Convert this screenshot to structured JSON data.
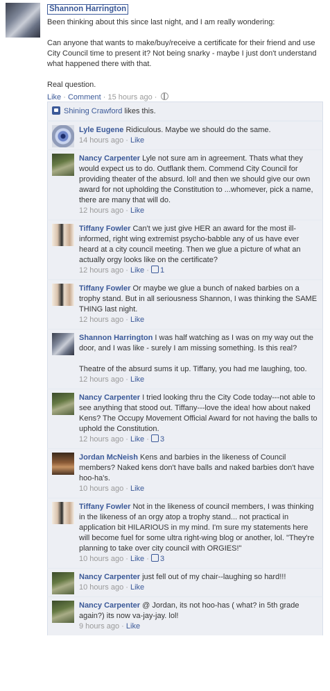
{
  "post": {
    "author": "Shannon Harrington",
    "text": "Been thinking about this since last night, and I am really wondering:\n\nCan anyone that wants to make/buy/receive a certificate for their friend and use City Council time to present it? Not being snarky - maybe I just don't understand what happened there with that.\n\nReal question.",
    "like_label": "Like",
    "comment_label": "Comment",
    "time": "15 hours ago",
    "privacy_icon": "globe-icon"
  },
  "likes": {
    "name": "Shining Crawford",
    "suffix": "likes this."
  },
  "comments": [
    {
      "author": "Lyle Eugene",
      "text": "Ridiculous. Maybe we should do the same.",
      "time": "14 hours ago",
      "like": "Like",
      "likes": ""
    },
    {
      "author": "Nancy Carpenter",
      "text": "Lyle not sure am in agreement. Thats what they would expect us to do. Outflank them. Commend City Council for providing theater of the absurd. lol! and then we should give our own award for not upholding the Constitution to ...whomever, pick a name, there are many that will do.",
      "time": "12 hours ago",
      "like": "Like",
      "likes": ""
    },
    {
      "author": "Tiffany Fowler",
      "text": "Can't we just give HER an award for the most ill-informed, right wing extremist psycho-babble any of us have ever heard at a city council meeting. Then we glue a picture of what an actually orgy looks like on the certificate?",
      "time": "12 hours ago",
      "like": "Like",
      "likes": "1"
    },
    {
      "author": "Tiffany Fowler",
      "text": "Or maybe we glue a bunch of naked barbies on a trophy stand. But in all seriousness Shannon, I was thinking the SAME THING last night.",
      "time": "12 hours ago",
      "like": "Like",
      "likes": ""
    },
    {
      "author": "Shannon Harrington",
      "text": "I was half watching as I was on my way out the door, and I was like - surely I am missing something. Is this real?\n\nTheatre of the absurd sums it up. Tiffany, you had me laughing, too.",
      "time": "12 hours ago",
      "like": "Like",
      "likes": ""
    },
    {
      "author": "Nancy Carpenter",
      "text": "I tried looking thru the City Code today---not able to see anything that stood out. Tiffany---love the idea! how about naked Kens? The Occupy Movement Official Award for not having the balls to uphold the Constitution.",
      "time": "12 hours ago",
      "like": "Like",
      "likes": "3"
    },
    {
      "author": "Jordan McNeish",
      "text": "Kens and barbies in the likeness of Council members? Naked kens don't have balls and naked barbies don't have hoo-ha's.",
      "time": "10 hours ago",
      "like": "Like",
      "likes": ""
    },
    {
      "author": "Tiffany Fowler",
      "text": "Not in the likeness of council members, I was thinking in the likeness of an orgy atop a trophy stand... not practical in application bit HILARIOUS in my mind. I'm sure my statements here will become fuel for some ultra right-wing blog or another, lol. \"They're planning to take over city council with ORGIES!\"",
      "time": "10 hours ago",
      "like": "Like",
      "likes": "3"
    },
    {
      "author": "Nancy Carpenter",
      "text": "just fell out of my chair--laughing so hard!!!",
      "time": "10 hours ago",
      "like": "Like",
      "likes": ""
    },
    {
      "author": "Nancy Carpenter",
      "text": "@ Jordan, its not hoo-has ( what? in 5th grade again?) its now va-jay-jay. lol!",
      "time": "9 hours ago",
      "like": "Like",
      "likes": ""
    }
  ]
}
